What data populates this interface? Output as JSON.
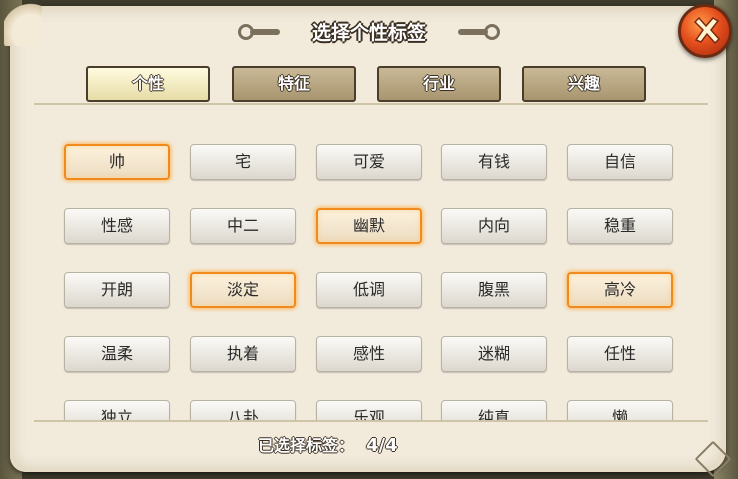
{
  "title": "选择个性标签",
  "tabs": [
    {
      "label": "个性",
      "active": true
    },
    {
      "label": "特征",
      "active": false
    },
    {
      "label": "行业",
      "active": false
    },
    {
      "label": "兴趣",
      "active": false
    }
  ],
  "tags": [
    [
      "帅",
      "宅",
      "可爱",
      "有钱",
      "自信"
    ],
    [
      "性感",
      "中二",
      "幽默",
      "内向",
      "稳重"
    ],
    [
      "开朗",
      "淡定",
      "低调",
      "腹黑",
      "高冷"
    ],
    [
      "温柔",
      "执着",
      "感性",
      "迷糊",
      "任性"
    ],
    [
      "独立",
      "八卦",
      "乐观",
      "纯真",
      "懒"
    ]
  ],
  "selected_tags": [
    "帅",
    "幽默",
    "淡定",
    "高冷"
  ],
  "status": {
    "label": "已选择标签：",
    "count": "4/4"
  },
  "icons": {
    "close": "close-x-icon"
  },
  "colors": {
    "selected_border": "#f08a1c",
    "close_button": "#e6501d",
    "active_tab": "#fffbe0"
  }
}
